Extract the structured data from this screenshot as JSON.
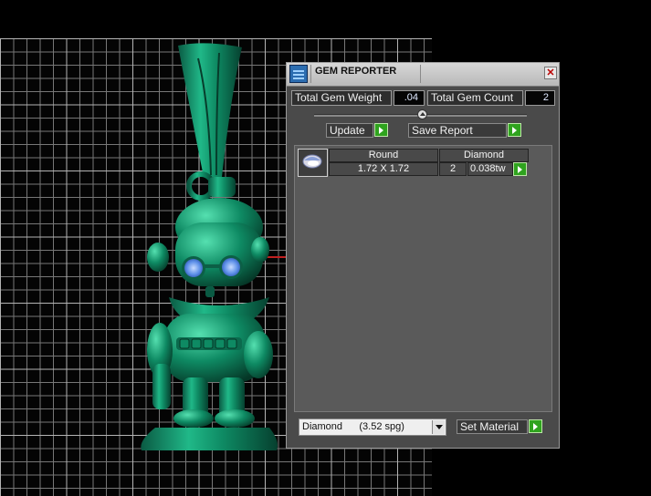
{
  "panel": {
    "title": "GEM REPORTER",
    "close_glyph": "✕",
    "total_gem_weight_label": "Total Gem Weight",
    "total_gem_weight_value": ".04",
    "total_gem_count_label": "Total Gem Count",
    "total_gem_count_value": "2",
    "update_label": "Update",
    "save_report_label": "Save Report",
    "gems": [
      {
        "shape": "Round",
        "material": "Diamond",
        "size": "1.72 X 1.72",
        "count": "2",
        "weight": "0.038tw"
      }
    ],
    "material_select_value": "Diamond      (3.52 spg)",
    "set_material_label": "Set Material"
  },
  "colors": {
    "panel_bg": "#4a4a4a",
    "go_button": "#2fa31e",
    "model_green": "#0e8a63",
    "axis_red": "#c02020"
  },
  "icons": {
    "app": "gem-reporter-icon",
    "close": "close-icon",
    "go": "play-arrow-icon",
    "gem": "round-diamond-icon",
    "dropdown": "chevron-down-icon"
  }
}
